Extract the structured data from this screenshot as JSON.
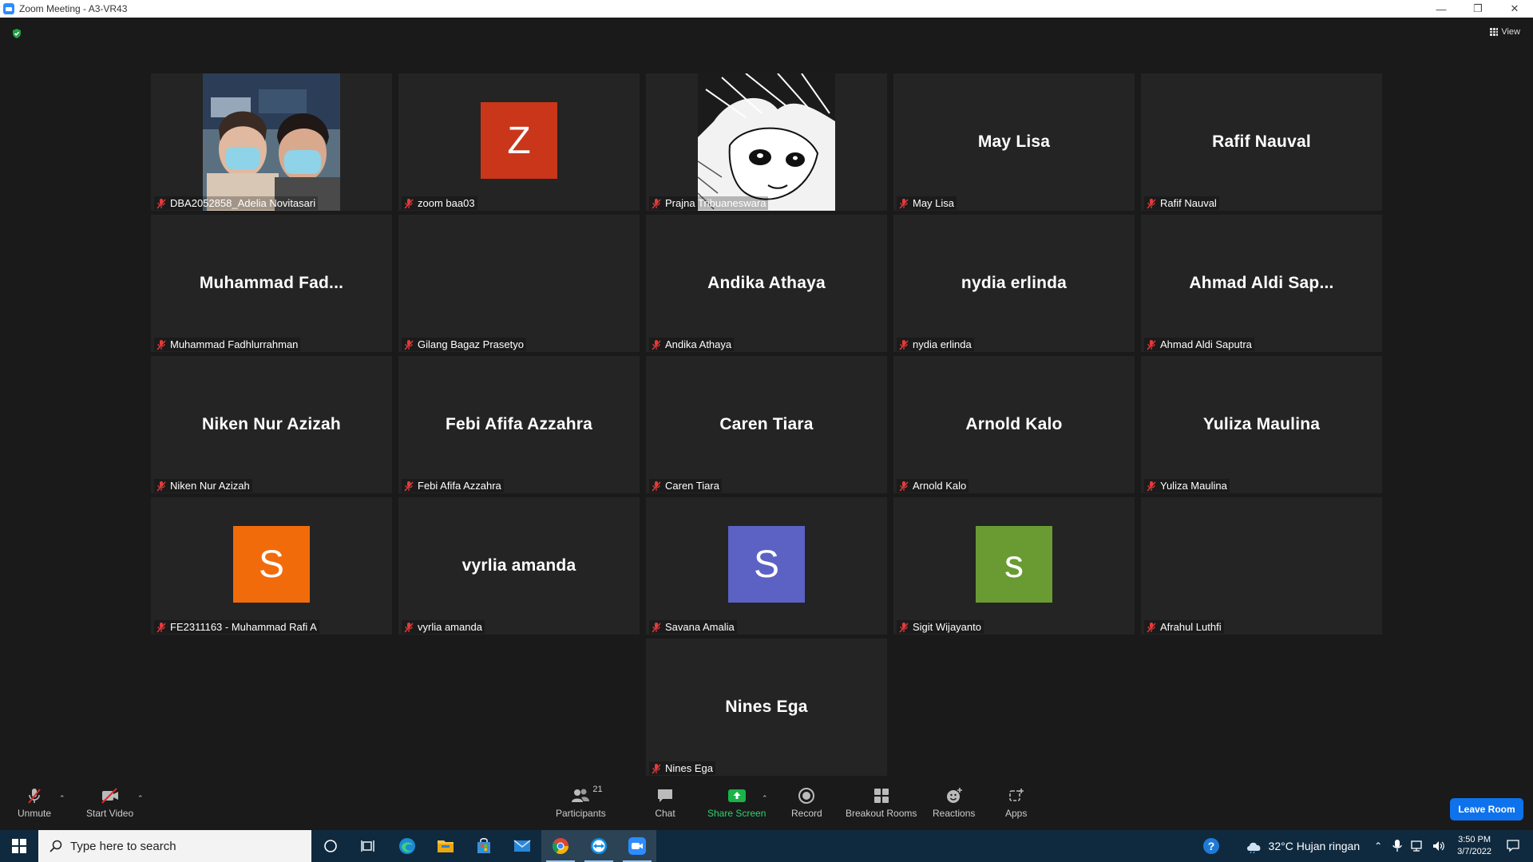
{
  "window": {
    "title": "Zoom Meeting - A3-VR43",
    "view_label": "View"
  },
  "tiles": [
    {
      "display": "",
      "label": "DBA2052858_Adelia Novitasari",
      "type": "photo"
    },
    {
      "display": "Z",
      "label": "zoom baa03",
      "type": "avatar",
      "color": "#c9361a"
    },
    {
      "display": "",
      "label": "Prajna Tribuaneswara",
      "type": "manga"
    },
    {
      "display": "May Lisa",
      "label": "May Lisa",
      "type": "name"
    },
    {
      "display": "Rafif Nauval",
      "label": "Rafif Nauval",
      "type": "name"
    },
    {
      "display": "Muhammad  Fad...",
      "label": "Muhammad Fadhlurrahman",
      "type": "name"
    },
    {
      "display": "",
      "label": "Gilang Bagaz Prasetyo",
      "type": "blank"
    },
    {
      "display": "Andika Athaya",
      "label": "Andika Athaya",
      "type": "name"
    },
    {
      "display": "nydia erlinda",
      "label": "nydia erlinda",
      "type": "name"
    },
    {
      "display": "Ahmad  Aldi  Sap...",
      "label": "Ahmad Aldi Saputra",
      "type": "name"
    },
    {
      "display": "Niken Nur Azizah",
      "label": "Niken Nur Azizah",
      "type": "name"
    },
    {
      "display": "Febi Afifa Azzahra",
      "label": "Febi Afifa Azzahra",
      "type": "name"
    },
    {
      "display": "Caren Tiara",
      "label": "Caren Tiara",
      "type": "name"
    },
    {
      "display": "Arnold Kalo",
      "label": "Arnold Kalo",
      "type": "name"
    },
    {
      "display": "Yuliza Maulina",
      "label": "Yuliza Maulina",
      "type": "name"
    },
    {
      "display": "S",
      "label": "FE2311163 - Muhammad Rafi A",
      "type": "avatar",
      "color": "#f26b0b"
    },
    {
      "display": "vyrlia amanda",
      "label": "vyrlia amanda",
      "type": "name"
    },
    {
      "display": "S",
      "label": "Savana Amalia",
      "type": "avatar",
      "color": "#5b62c4"
    },
    {
      "display": "s",
      "label": "Sigit Wijayanto",
      "type": "avatar",
      "color": "#6a9b32"
    },
    {
      "display": "",
      "label": "Afrahul Luthfi",
      "type": "blank"
    },
    {
      "display": "Nines Ega",
      "label": "Nines Ega",
      "type": "name"
    }
  ],
  "toolbar": {
    "unmute": "Unmute",
    "start_video": "Start Video",
    "participants": "Participants",
    "participant_count": "21",
    "chat": "Chat",
    "share_screen": "Share Screen",
    "record": "Record",
    "breakout_rooms": "Breakout Rooms",
    "reactions": "Reactions",
    "apps": "Apps",
    "leave_room": "Leave Room"
  },
  "taskbar": {
    "search_placeholder": "Type here to search",
    "weather": "32°C  Hujan ringan",
    "time": "3:50 PM",
    "date": "3/7/2022"
  }
}
